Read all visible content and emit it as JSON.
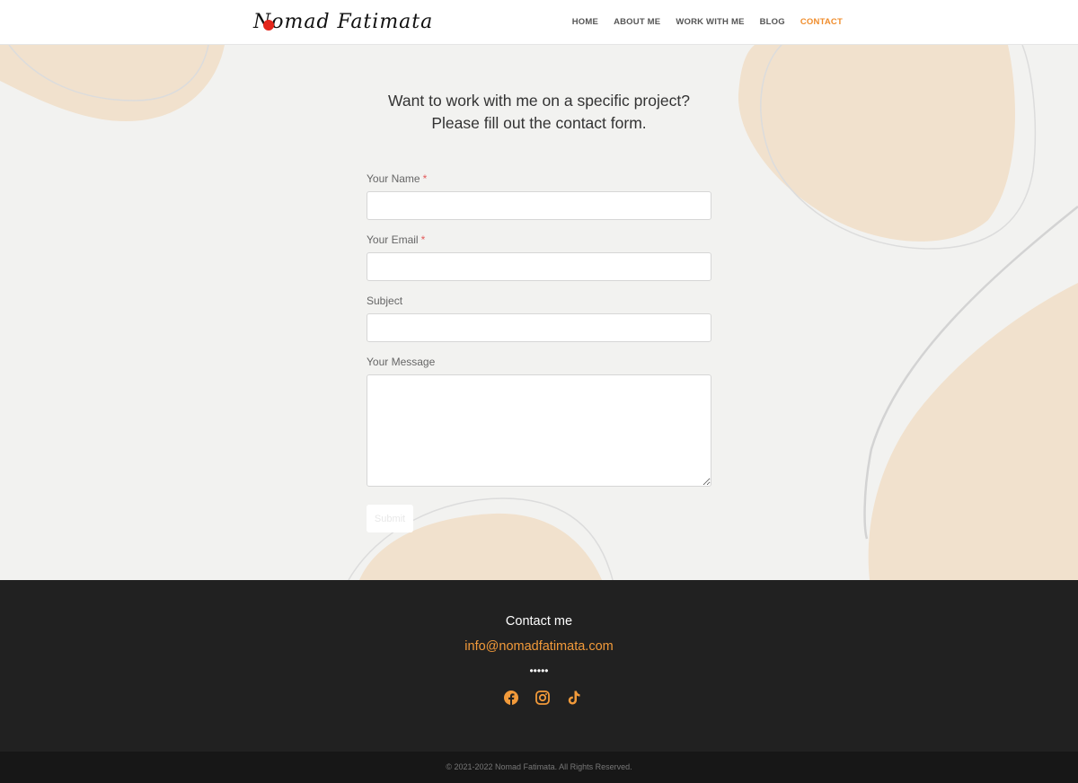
{
  "header": {
    "logo_text": "Nomad Fatimata",
    "nav": [
      "HOME",
      "ABOUT ME",
      "WORK WITH ME",
      "BLOG",
      "CONTACT"
    ],
    "active": "CONTACT"
  },
  "main": {
    "heading_line1": "Want to work with me on a specific project?",
    "heading_line2": "Please fill out the contact form."
  },
  "form": {
    "name_label": "Your Name",
    "email_label": "Your Email",
    "subject_label": "Subject",
    "message_label": "Your Message",
    "required_mark": "*",
    "submit_label": "Submit"
  },
  "footer": {
    "contact_title": "Contact me",
    "email": "info@nomadfatimata.com",
    "separator": "•••••",
    "socials": [
      "facebook-icon",
      "instagram-icon",
      "tiktok-icon"
    ],
    "copyright": "© 2021-2022 Nomad Fatimata. All Rights Reserved."
  },
  "colors": {
    "accent": "#f08d2c",
    "blob": "#f1e1cd",
    "footer_bg": "#212121"
  }
}
